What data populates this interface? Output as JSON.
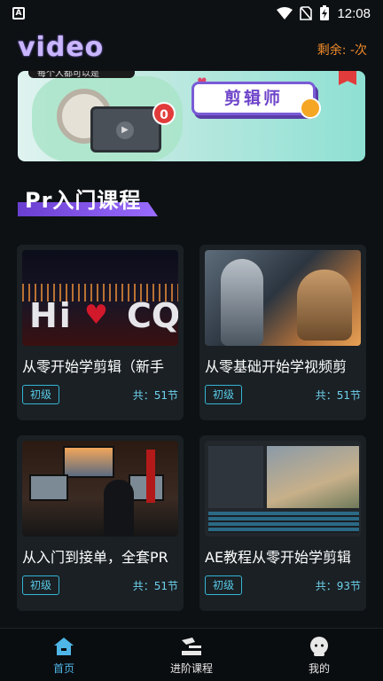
{
  "status_bar": {
    "time": "12:08"
  },
  "header": {
    "logo": "video",
    "remaining": "剩余: -次"
  },
  "banner": {
    "top_text": "每个人都可以是",
    "badge_count": "0",
    "label": "剪辑师"
  },
  "section": {
    "title": "Pr入门课程"
  },
  "courses": [
    {
      "title": "从零开始学剪辑（新手",
      "level": "初级",
      "count": "共：51节",
      "thumb_text_left": "Hi",
      "thumb_text_right": "CQ"
    },
    {
      "title": "从零基础开始学视频剪",
      "level": "初级",
      "count": "共：51节"
    },
    {
      "title": "从入门到接单，全套PR",
      "level": "初级",
      "count": "共：51节"
    },
    {
      "title": "AE教程从零开始学剪辑",
      "level": "初级",
      "count": "共：93节"
    }
  ],
  "bottom_nav": [
    {
      "label": "首页",
      "icon": "home-icon",
      "active": true
    },
    {
      "label": "进阶课程",
      "icon": "advanced-course-icon",
      "active": false
    },
    {
      "label": "我的",
      "icon": "profile-icon",
      "active": false
    }
  ],
  "colors": {
    "accent": "#4fb6e8",
    "remaining": "#f08a2a",
    "section_bar": "#7a4fe0",
    "card_bg": "#1a2024"
  }
}
